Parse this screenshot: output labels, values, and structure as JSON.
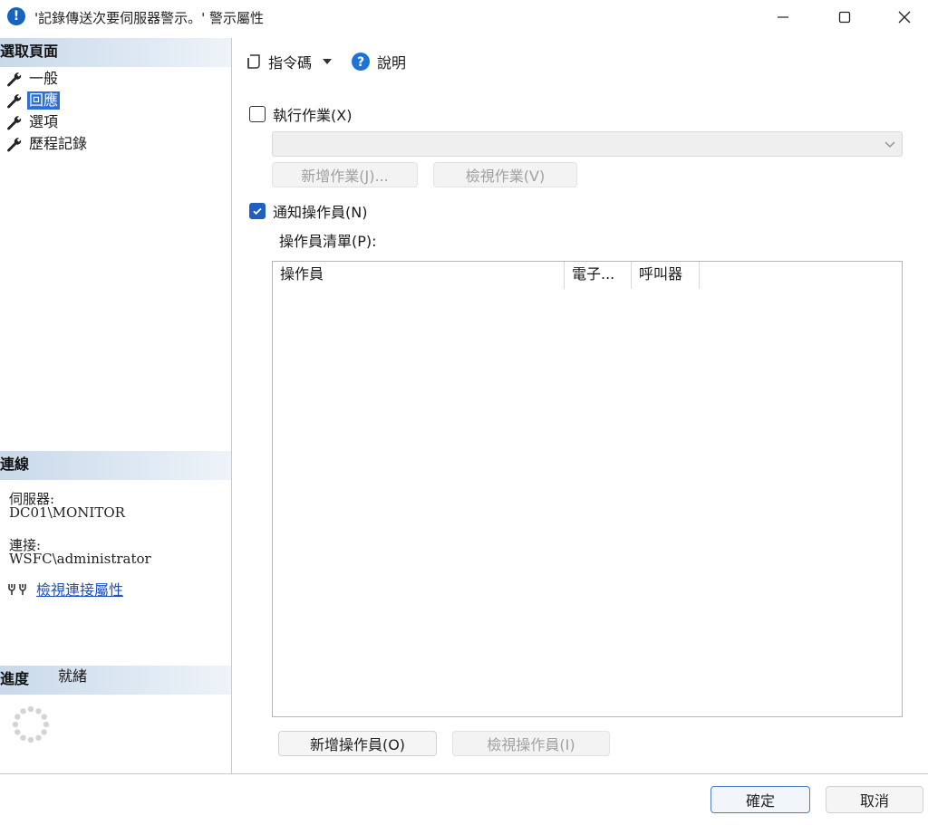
{
  "window": {
    "title": "'記錄傳送次要伺服器警示。' 警示屬性",
    "title_icon": "info-icon",
    "accent": "#1664c0"
  },
  "left_panel": {
    "pages_header": "選取頁面",
    "pages": [
      {
        "label": "一般",
        "icon": "wrench-icon",
        "selected": false
      },
      {
        "label": "回應",
        "icon": "wrench-icon",
        "selected": true
      },
      {
        "label": "選項",
        "icon": "wrench-icon",
        "selected": false
      },
      {
        "label": "歷程記錄",
        "icon": "wrench-icon",
        "selected": false
      }
    ],
    "connection_header": "連線",
    "server_label": "伺服器:",
    "server_value": "DC01\\MONITOR",
    "connection_label": "連接:",
    "connection_value": "WSFC\\administrator",
    "view_connection_link": "檢視連接屬性",
    "progress_header": "進度",
    "progress_status": "就緒"
  },
  "toolbar": {
    "script_label": "指令碼",
    "help_label": "說明"
  },
  "response": {
    "execute_job_label": "執行作業(X)",
    "execute_job_checked": false,
    "job_combo_value": "",
    "new_job_button": "新增作業(J)...",
    "view_job_button": "檢視作業(V)",
    "notify_operators_label": "通知操作員(N)",
    "notify_operators_checked": true,
    "operator_list_label": "操作員清單(P):",
    "operator_list_columns": [
      "操作員",
      "電子...",
      "呼叫器"
    ],
    "operator_rows": [],
    "new_operator_button": "新增操作員(O)",
    "view_operator_button": "檢視操作員(I)"
  },
  "footer": {
    "ok_button": "確定",
    "cancel_button": "取消"
  },
  "colors": {
    "selection": "#2d6fd8",
    "link": "#1a4fc9",
    "section_header": "#c9d9ea",
    "checkbox_checked": "#1f5fbf"
  }
}
